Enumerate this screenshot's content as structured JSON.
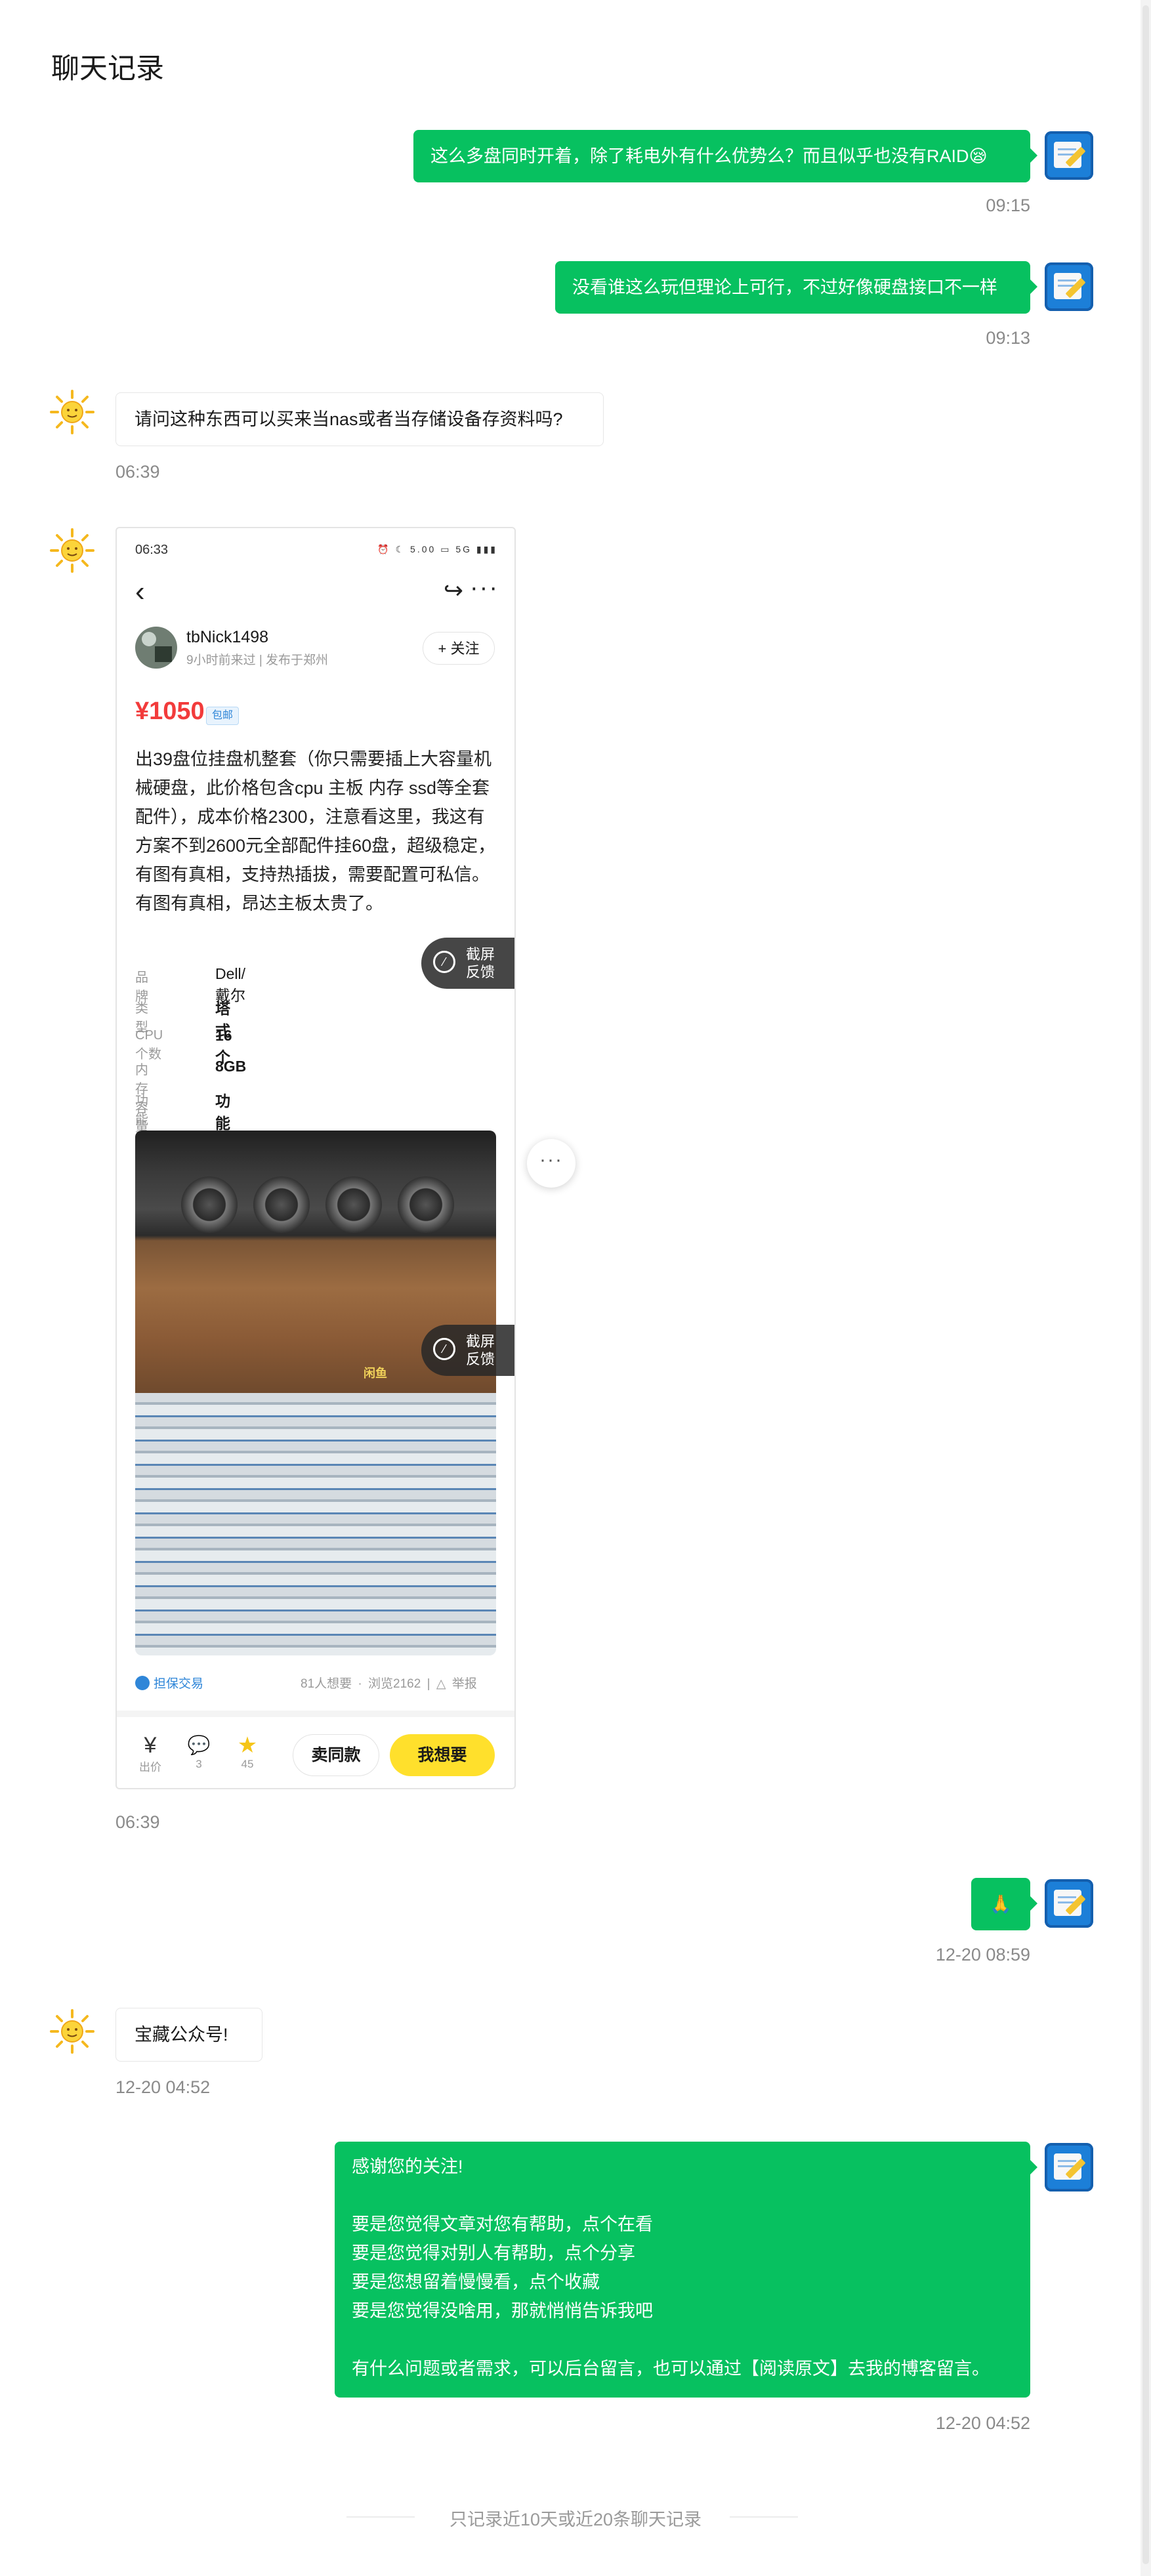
{
  "page": {
    "title": "聊天记录"
  },
  "messages": [
    {
      "text": "这么多盘同时开着，除了耗电外有什么优势么？而且似乎也没有RAID😪",
      "time": "09:15"
    },
    {
      "text": "没看谁这么玩但理论上可行，不过好像硬盘接口不一样",
      "time": "09:13"
    },
    {
      "text": "请问这种东西可以买来当nas或者当存储设备存资料吗?",
      "time": "06:39"
    },
    {
      "time": "06:39"
    },
    {
      "text": "🙏",
      "time": "12-20 08:59"
    },
    {
      "text": "宝藏公众号!",
      "time": "12-20 04:52"
    },
    {
      "lines": [
        "感谢您的关注!",
        "",
        "要是您觉得文章对您有帮助，点个在看",
        "要是您觉得对别人有帮助，点个分享",
        "要是您想留着慢慢看，点个收藏",
        "要是您觉得没啥用，那就悄悄告诉我吧",
        "",
        "有什么问题或者需求，可以后台留言，也可以通过【阅读原文】去我的博客留言。"
      ],
      "time": "12-20 04:52"
    }
  ],
  "listing": {
    "status_time": "06:33",
    "status_icons": "⏰ ☾ 5.00 ▭ 5G ▮▮▮",
    "seller_name": "tbNick1498",
    "seller_meta": "9小时前来过 | 发布于郑州",
    "follow_label": "+ 关注",
    "price": "¥1050",
    "shipping_tag": "包邮",
    "description": "出39盘位挂盘机整套（你只需要插上大容量机械硬盘，此价格包含cpu 主板 内存 ssd等全套配件），成本价格2300，注意看这里，我这有方案不到2600元全部配件挂60盘，超级稳定，有图有真相，支持热插拔，需要配置可私信。有图有真相，昂达主板太贵了。",
    "specs": [
      {
        "key": "品牌",
        "value": "Dell/戴尔"
      },
      {
        "key": "类型",
        "value": "塔式"
      },
      {
        "key": "CPU个数",
        "value": "16个"
      },
      {
        "key": "内存容量",
        "value": "8GB"
      },
      {
        "key": "功能状态",
        "value": "功能完好无维修"
      }
    ],
    "feedback_line1": "截屏",
    "feedback_line2": "反馈",
    "watermark": "闲鱼",
    "guarantee": "担保交易",
    "want_count": "81人想要",
    "views": "浏览2162",
    "report": "△ 举报",
    "actions": [
      {
        "icon": "¥",
        "label": "出价"
      },
      {
        "icon": "💬",
        "label": "3"
      },
      {
        "icon": "★",
        "label": "45"
      }
    ],
    "sell_same": "卖同款",
    "want": "我想要"
  },
  "more_button": "···",
  "footer": "只记录近10天或近20条聊天记录",
  "colors": {
    "outgoing": "#07c160",
    "price": "#f23b3b",
    "want_button": "#ffe02c",
    "avatar_blue": "#1c7fd8"
  }
}
